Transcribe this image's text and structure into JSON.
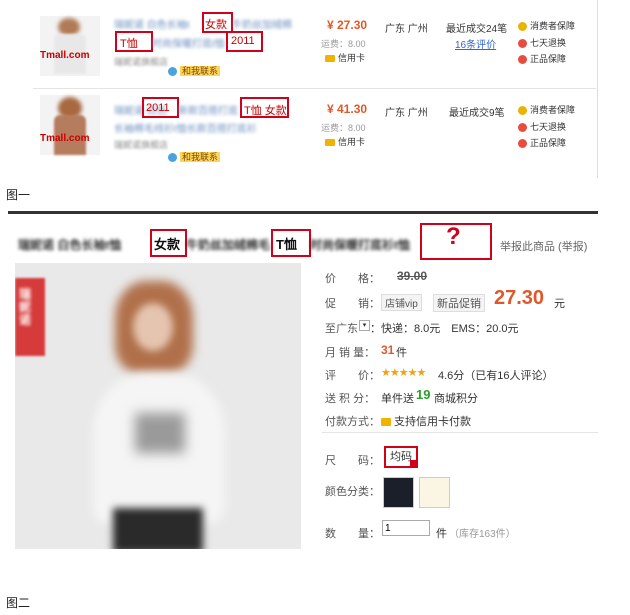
{
  "figure1": {
    "label": "图一",
    "items": [
      {
        "title_tag1": "女款",
        "title_tag2": "T恤",
        "title_tag3": "2011",
        "price": "¥ 27.30",
        "shipping": "运费：8.00",
        "credit": "信用卡",
        "location": "广东 广州",
        "deals": "最近成交24笔",
        "reviews": "16条评价",
        "service1": "消费者保障",
        "service2": "七天退换",
        "service3": "正品保障",
        "brand": "Tmall.com",
        "chat": "和我联系"
      },
      {
        "title_tag1": "2011",
        "title_tag2": "T恤 女款",
        "price": "¥ 41.30",
        "shipping": "运费：8.00",
        "credit": "信用卡",
        "location": "广东 广州",
        "deals": "最近成交9笔",
        "service1": "消费者保障",
        "service2": "七天退换",
        "service3": "正品保障",
        "brand": "Tmall.com",
        "chat": "和我联系"
      }
    ]
  },
  "figure2": {
    "label": "图二",
    "title_tag1": "女款",
    "title_tag2": "T恤",
    "question_mark": "?",
    "report": "举报此商品 (举报)",
    "price_label": "价　　格：",
    "original_price": "39.00",
    "promo_label": "促　　销：",
    "promo_badge": "店铺vip",
    "promo_new": "新品促销",
    "promo_price": "27.30",
    "promo_unit": "元",
    "ship_label": "至广东",
    "ship_value": "：快递：8.0元　EMS：20.0元",
    "sales_label": "月 销 量：",
    "sales_value": "31",
    "sales_unit": "件",
    "rating_label": "评　　价：",
    "rating_stars": "★★★★★",
    "rating_value": "4.6分（已有16人评论）",
    "points_label": "送 积 分：",
    "points_prefix": "单件送",
    "points_value": "19",
    "points_suffix": "商城积分",
    "pay_label": "付款方式：",
    "pay_value": "支持信用卡付款",
    "size_label": "尺　　码：",
    "size_value": "均码",
    "color_label": "颜色分类：",
    "qty_label": "数　　量：",
    "qty_value": "1",
    "qty_unit": "件",
    "stock": "（库存163件）",
    "store_badge": "瑞妮诺"
  }
}
